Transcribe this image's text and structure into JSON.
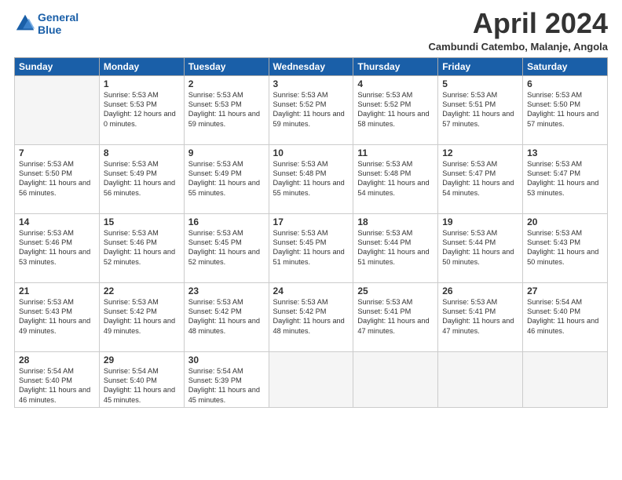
{
  "header": {
    "logo_line1": "General",
    "logo_line2": "Blue",
    "title": "April 2024",
    "subtitle": "Cambundi Catembo, Malanje, Angola"
  },
  "days_of_week": [
    "Sunday",
    "Monday",
    "Tuesday",
    "Wednesday",
    "Thursday",
    "Friday",
    "Saturday"
  ],
  "weeks": [
    [
      {
        "day": "",
        "info": ""
      },
      {
        "day": "1",
        "info": "Sunrise: 5:53 AM\nSunset: 5:53 PM\nDaylight: 12 hours\nand 0 minutes."
      },
      {
        "day": "2",
        "info": "Sunrise: 5:53 AM\nSunset: 5:53 PM\nDaylight: 11 hours\nand 59 minutes."
      },
      {
        "day": "3",
        "info": "Sunrise: 5:53 AM\nSunset: 5:52 PM\nDaylight: 11 hours\nand 59 minutes."
      },
      {
        "day": "4",
        "info": "Sunrise: 5:53 AM\nSunset: 5:52 PM\nDaylight: 11 hours\nand 58 minutes."
      },
      {
        "day": "5",
        "info": "Sunrise: 5:53 AM\nSunset: 5:51 PM\nDaylight: 11 hours\nand 57 minutes."
      },
      {
        "day": "6",
        "info": "Sunrise: 5:53 AM\nSunset: 5:50 PM\nDaylight: 11 hours\nand 57 minutes."
      }
    ],
    [
      {
        "day": "7",
        "info": "Sunrise: 5:53 AM\nSunset: 5:50 PM\nDaylight: 11 hours\nand 56 minutes."
      },
      {
        "day": "8",
        "info": "Sunrise: 5:53 AM\nSunset: 5:49 PM\nDaylight: 11 hours\nand 56 minutes."
      },
      {
        "day": "9",
        "info": "Sunrise: 5:53 AM\nSunset: 5:49 PM\nDaylight: 11 hours\nand 55 minutes."
      },
      {
        "day": "10",
        "info": "Sunrise: 5:53 AM\nSunset: 5:48 PM\nDaylight: 11 hours\nand 55 minutes."
      },
      {
        "day": "11",
        "info": "Sunrise: 5:53 AM\nSunset: 5:48 PM\nDaylight: 11 hours\nand 54 minutes."
      },
      {
        "day": "12",
        "info": "Sunrise: 5:53 AM\nSunset: 5:47 PM\nDaylight: 11 hours\nand 54 minutes."
      },
      {
        "day": "13",
        "info": "Sunrise: 5:53 AM\nSunset: 5:47 PM\nDaylight: 11 hours\nand 53 minutes."
      }
    ],
    [
      {
        "day": "14",
        "info": "Sunrise: 5:53 AM\nSunset: 5:46 PM\nDaylight: 11 hours\nand 53 minutes."
      },
      {
        "day": "15",
        "info": "Sunrise: 5:53 AM\nSunset: 5:46 PM\nDaylight: 11 hours\nand 52 minutes."
      },
      {
        "day": "16",
        "info": "Sunrise: 5:53 AM\nSunset: 5:45 PM\nDaylight: 11 hours\nand 52 minutes."
      },
      {
        "day": "17",
        "info": "Sunrise: 5:53 AM\nSunset: 5:45 PM\nDaylight: 11 hours\nand 51 minutes."
      },
      {
        "day": "18",
        "info": "Sunrise: 5:53 AM\nSunset: 5:44 PM\nDaylight: 11 hours\nand 51 minutes."
      },
      {
        "day": "19",
        "info": "Sunrise: 5:53 AM\nSunset: 5:44 PM\nDaylight: 11 hours\nand 50 minutes."
      },
      {
        "day": "20",
        "info": "Sunrise: 5:53 AM\nSunset: 5:43 PM\nDaylight: 11 hours\nand 50 minutes."
      }
    ],
    [
      {
        "day": "21",
        "info": "Sunrise: 5:53 AM\nSunset: 5:43 PM\nDaylight: 11 hours\nand 49 minutes."
      },
      {
        "day": "22",
        "info": "Sunrise: 5:53 AM\nSunset: 5:42 PM\nDaylight: 11 hours\nand 49 minutes."
      },
      {
        "day": "23",
        "info": "Sunrise: 5:53 AM\nSunset: 5:42 PM\nDaylight: 11 hours\nand 48 minutes."
      },
      {
        "day": "24",
        "info": "Sunrise: 5:53 AM\nSunset: 5:42 PM\nDaylight: 11 hours\nand 48 minutes."
      },
      {
        "day": "25",
        "info": "Sunrise: 5:53 AM\nSunset: 5:41 PM\nDaylight: 11 hours\nand 47 minutes."
      },
      {
        "day": "26",
        "info": "Sunrise: 5:53 AM\nSunset: 5:41 PM\nDaylight: 11 hours\nand 47 minutes."
      },
      {
        "day": "27",
        "info": "Sunrise: 5:54 AM\nSunset: 5:40 PM\nDaylight: 11 hours\nand 46 minutes."
      }
    ],
    [
      {
        "day": "28",
        "info": "Sunrise: 5:54 AM\nSunset: 5:40 PM\nDaylight: 11 hours\nand 46 minutes."
      },
      {
        "day": "29",
        "info": "Sunrise: 5:54 AM\nSunset: 5:40 PM\nDaylight: 11 hours\nand 45 minutes."
      },
      {
        "day": "30",
        "info": "Sunrise: 5:54 AM\nSunset: 5:39 PM\nDaylight: 11 hours\nand 45 minutes."
      },
      {
        "day": "",
        "info": ""
      },
      {
        "day": "",
        "info": ""
      },
      {
        "day": "",
        "info": ""
      },
      {
        "day": "",
        "info": ""
      }
    ]
  ]
}
